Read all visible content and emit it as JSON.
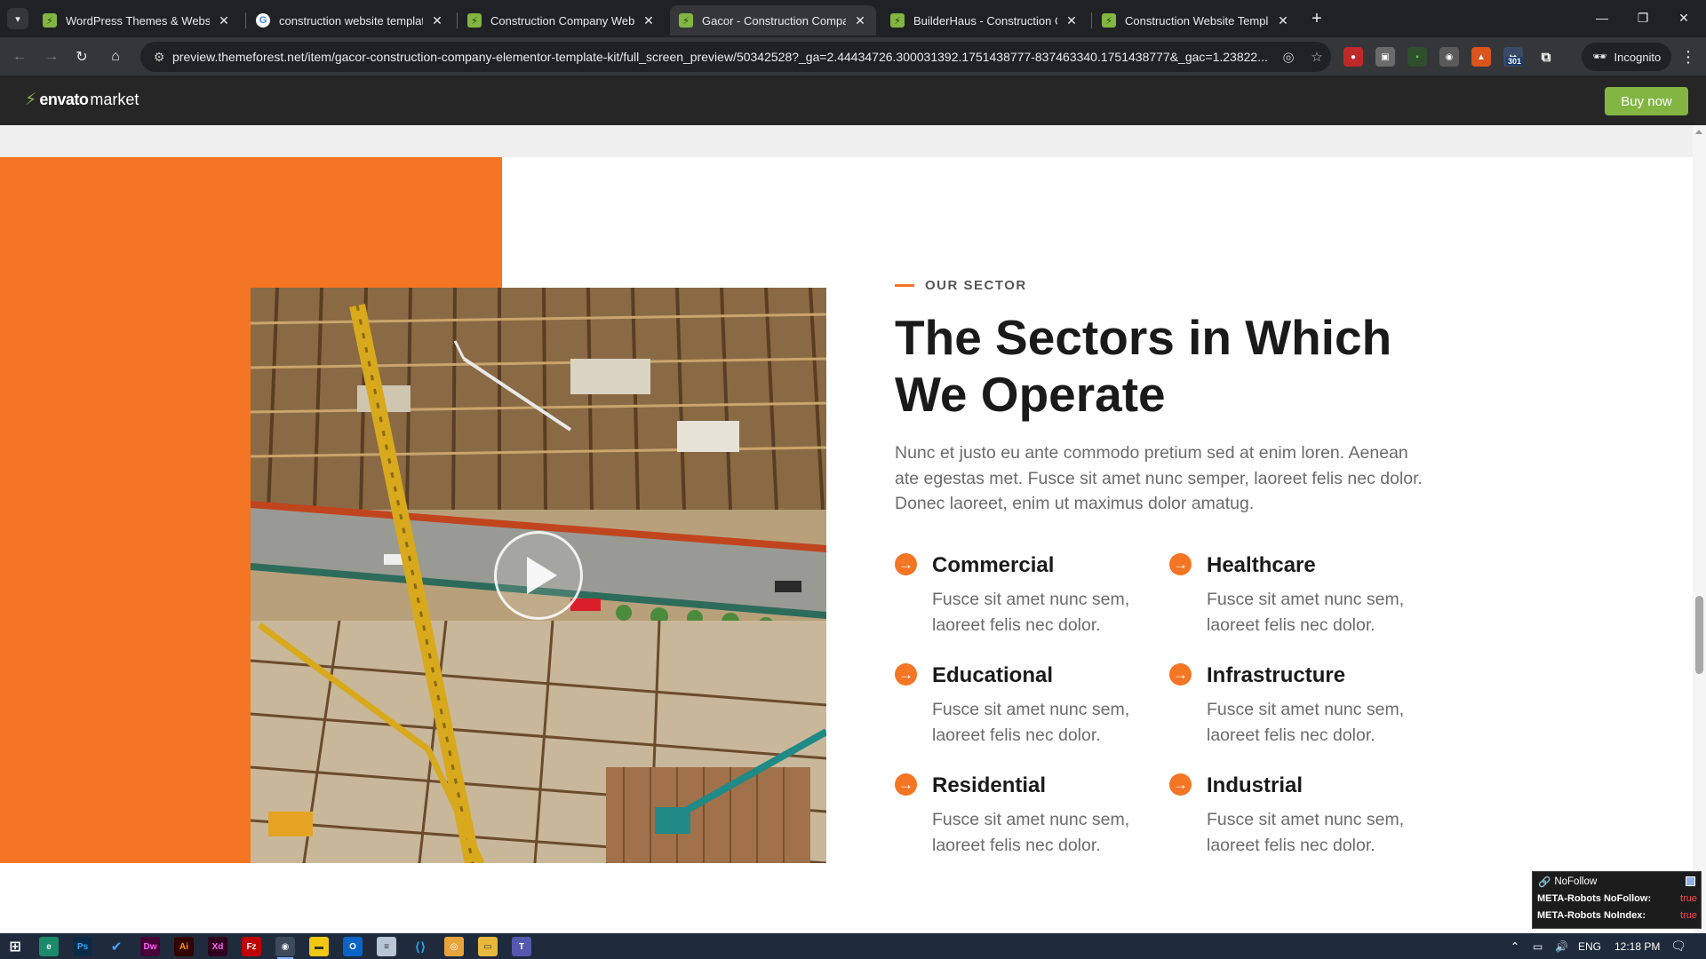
{
  "browser": {
    "tabs": [
      {
        "title": "WordPress Themes & Website Templates",
        "favicon": "envato-icon",
        "active": false
      },
      {
        "title": "construction website template - Google Search",
        "favicon": "google-icon",
        "active": false
      },
      {
        "title": "Construction Company Website Templates",
        "favicon": "envato-icon",
        "active": false
      },
      {
        "title": "Gacor - Construction Company Elementor Template Kit",
        "favicon": "envato-icon",
        "active": true
      },
      {
        "title": "BuilderHaus - Construction Company Template",
        "favicon": "envato-icon",
        "active": false
      },
      {
        "title": "Construction Website Templates",
        "favicon": "envato-icon",
        "active": false
      }
    ],
    "url": "preview.themeforest.net/item/gacor-construction-company-elementor-template-kit/full_screen_preview/50342528?_ga=2.44434726.300031392.1751438777-837463340.1751438777&_gac=1.23822...",
    "incognito_label": "Incognito",
    "extension_badge": "301"
  },
  "envato": {
    "logo_brand": "envato",
    "logo_market": "market",
    "buy_label": "Buy now"
  },
  "section": {
    "eyebrow": "OUR SECTOR",
    "heading": "The Sectors in Which We Operate",
    "intro": "Nunc et justo eu ante commodo pretium sed at enim loren. Aenean ate egestas met. Fusce sit amet nunc semper, laoreet felis nec dolor. Donec laoreet, enim ut maximus dolor amatug.",
    "sectors": [
      {
        "name": "Commercial",
        "desc": "Fusce sit amet nunc sem, laoreet felis nec dolor."
      },
      {
        "name": "Healthcare",
        "desc": "Fusce sit amet nunc sem, laoreet felis nec dolor."
      },
      {
        "name": "Educational",
        "desc": "Fusce sit amet nunc sem, laoreet felis nec dolor."
      },
      {
        "name": "Infrastructure",
        "desc": "Fusce sit amet nunc sem, laoreet felis nec dolor."
      },
      {
        "name": "Residential",
        "desc": "Fusce sit amet nunc sem, laoreet felis nec dolor."
      },
      {
        "name": "Industrial",
        "desc": "Fusce sit amet nunc sem, laoreet felis nec dolor."
      }
    ]
  },
  "nofollow_panel": {
    "title": "NoFollow",
    "rows": [
      {
        "key": "META-Robots NoFollow:",
        "value": "true"
      },
      {
        "key": "META-Robots NoIndex:",
        "value": "true"
      }
    ]
  },
  "taskbar": {
    "language": "ENG",
    "time": "12:18 PM"
  },
  "colors": {
    "accent_orange": "#f47523",
    "envato_green": "#82b541",
    "heading_dark": "#1a1a1a",
    "body_gray": "#6b6b6b"
  }
}
